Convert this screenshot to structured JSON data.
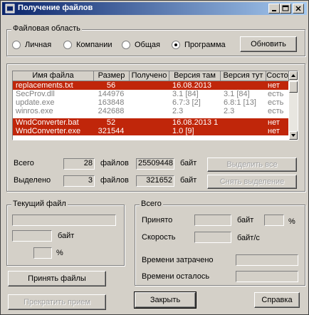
{
  "window": {
    "title": "Получение файлов"
  },
  "area": {
    "group_label": "Файловая область",
    "options": [
      "Личная",
      "Компании",
      "Общая",
      "Программа"
    ],
    "selected": "Программа",
    "refresh_label": "Обновить"
  },
  "table": {
    "columns": [
      "Имя файла",
      "Размер",
      "Получено",
      "Версия там",
      "Версия тут",
      "Состо"
    ],
    "rows": [
      {
        "name": "replacements.txt",
        "size": "56",
        "received": "",
        "ver_there": "16.08.2013",
        "ver_here": "",
        "state": "нет",
        "selected": true
      },
      {
        "name": "SecProv.dll",
        "size": "144976",
        "received": "",
        "ver_there": "3.1 [84]",
        "ver_here": "3.1 [84]",
        "state": "есть",
        "selected": false
      },
      {
        "name": "update.exe",
        "size": "163848",
        "received": "",
        "ver_there": "6.7:3 [2]",
        "ver_here": "6.8:1 [13]",
        "state": "есть",
        "selected": false
      },
      {
        "name": "winros.exe",
        "size": "242688",
        "received": "",
        "ver_there": "2.3",
        "ver_here": "2.3",
        "state": "есть",
        "selected": false
      },
      {
        "name": "WndConverter.bat",
        "size": "52",
        "received": "",
        "ver_there": "16.08.2013 1",
        "ver_here": "",
        "state": "нет",
        "selected": true
      },
      {
        "name": "WndConverter.exe",
        "size": "321544",
        "received": "",
        "ver_there": "1.0 [9]",
        "ver_here": "",
        "state": "нет",
        "selected": true
      }
    ]
  },
  "totals": {
    "total_label": "Всего",
    "total_files": "28",
    "files_label": "файлов",
    "total_bytes": "25509448",
    "bytes_label": "байт",
    "selected_label": "Выделено",
    "selected_files": "3",
    "selected_bytes": "321652",
    "select_all_label": "Выделить все",
    "deselect_label": "Снять выделение"
  },
  "current_file": {
    "group_label": "Текущий файл",
    "bytes_label": "байт",
    "percent_label": "%"
  },
  "overall": {
    "group_label": "Всего",
    "received_label": "Принято",
    "bytes_label": "байт",
    "percent_label": "%",
    "speed_label": "Скорость",
    "speed_unit": "байт/с",
    "time_spent_label": "Времени затрачено",
    "time_left_label": "Времени осталось"
  },
  "buttons": {
    "receive": "Принять файлы",
    "stop": "Прекратить прием",
    "close": "Закрыть",
    "help": "Справка"
  }
}
